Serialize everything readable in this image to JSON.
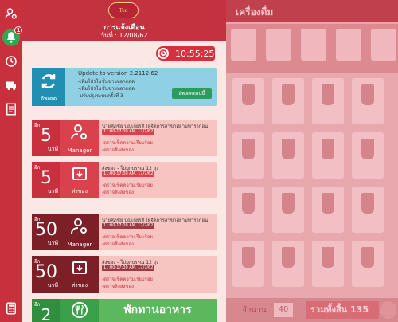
{
  "panel": {
    "logo_text": "Tea",
    "title": "การแจ้งเตือน",
    "date": "วันที่ : 12/08/62",
    "clock": "10:55:25"
  },
  "sidebar": {
    "badge_count": "1",
    "items": [
      {
        "icon": "user-gear-icon"
      },
      {
        "icon": "bell-icon"
      },
      {
        "icon": "history-icon"
      },
      {
        "icon": "delivery-icon"
      },
      {
        "icon": "document-icon"
      },
      {
        "icon": "calculator-icon"
      }
    ]
  },
  "update_card": {
    "icon_label": "อัพเดต",
    "title": "Update to version 2.2112.62",
    "lines": [
      "-เพิ่มโปรโมชั่นขายหลาดสด",
      "-เพิ่มโปรโมชั่นขายหลาดสด",
      "-ปรับปรุงระบบครั้งที่ 3"
    ],
    "button": "อัพเดตตอนนี้"
  },
  "cards": [
    {
      "remain": "อีก",
      "num": "5",
      "unit": "นาที",
      "role": "Manager",
      "icon": "manager-icon",
      "name": "นายศุภชัย บุญเกียรติ (ผู้จัดการสาขาสยามพารากอน)",
      "time": "11:00-17:00 AM, 17/7/62",
      "items": [
        "-ตรวจเช็คความเรียบร้อย",
        "-ตรวจสิงส่งของ"
      ]
    },
    {
      "remain": "อีก",
      "num": "5",
      "unit": "นาที",
      "role": "ส่งของ",
      "icon": "delivery-box-icon",
      "name": "ส่งของ - ใบ่มุกบรรณ 12 ถุง",
      "time": "11:00-17:00 AM, 17/7/62",
      "items": [
        "-ตรวจเช็คความเรียบร้อย",
        "-ตรวจสิงส่งของ"
      ]
    },
    {
      "remain": "อีก",
      "num": "50",
      "unit": "นาที",
      "role": "Manager",
      "icon": "manager-icon",
      "name": "นายศุภชัย บุญเกียรติ (ผู้จัดการสาขาสยามพารากอน)",
      "time": "11:00-17:00 AM, 17/7/62",
      "items": [
        "-ตรวจเช็คความเรียบร้อย",
        "-ตรวจสิงส่งของ"
      ]
    },
    {
      "remain": "อีก",
      "num": "50",
      "unit": "นาที",
      "role": "ส่งของ",
      "icon": "delivery-box-icon",
      "name": "ส่งของ - ใบ่มุกบรรณ 12 ถุง",
      "time": "11:00-17:00 AM, 17/7/62",
      "items": [
        "-ตรวจเช็คความเรียบร้อย",
        "-ตรวจสิงส่งของ"
      ]
    }
  ],
  "break_card": {
    "remain": "อีก",
    "num": "2",
    "text": "พักทานอาหาร"
  },
  "background": {
    "title": "เครื่องดื่ม",
    "qty_label": "จำนวน",
    "qty": "40",
    "total": "รวมทั้งสิ้น 135"
  }
}
